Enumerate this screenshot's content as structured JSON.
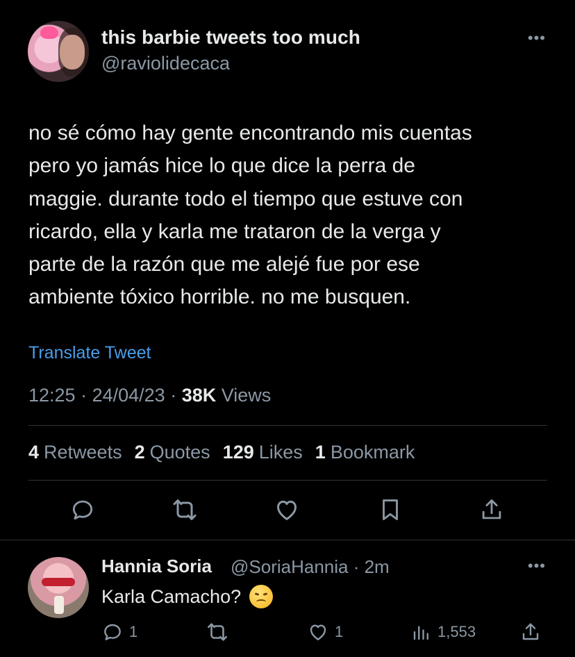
{
  "tweet": {
    "display_name": "this barbie tweets too much",
    "handle": "@raviolidecaca",
    "more_label": "•••",
    "body": "no sé cómo hay gente encontrando mis cuentas\npero yo jamás hice lo que dice la perra de\nmaggie. durante todo el tiempo que estuve con\nricardo, ella y karla me trataron de la verga y\nparte de la razón que me alejé fue por ese\nambiente tóxico horrible. no me busquen.",
    "translate_label": "Translate Tweet",
    "time": "12:25",
    "date": "24/04/23",
    "views_count": "38K",
    "views_label": "Views",
    "stats": {
      "retweets_count": "4",
      "retweets_label": "Retweets",
      "quotes_count": "2",
      "quotes_label": "Quotes",
      "likes_count": "129",
      "likes_label": "Likes",
      "bookmarks_count": "1",
      "bookmarks_label": "Bookmark"
    },
    "actions": [
      "reply-icon",
      "retweet-icon",
      "like-icon",
      "bookmark-icon",
      "share-icon"
    ]
  },
  "reply": {
    "display_name": "Hannia Soria",
    "handle": "@SoriaHannia",
    "time": "2m",
    "more_label": "•••",
    "text": "Karla Camacho?",
    "emoji": "disappointed-face-emoji",
    "replies_count": "1",
    "likes_count": "1",
    "views_count": "1,553"
  },
  "colors": {
    "background": "#000000",
    "text_primary": "#e7e9ea",
    "text_secondary": "#8b98a5",
    "link": "#4a9dea",
    "divider": "#2f3336"
  }
}
